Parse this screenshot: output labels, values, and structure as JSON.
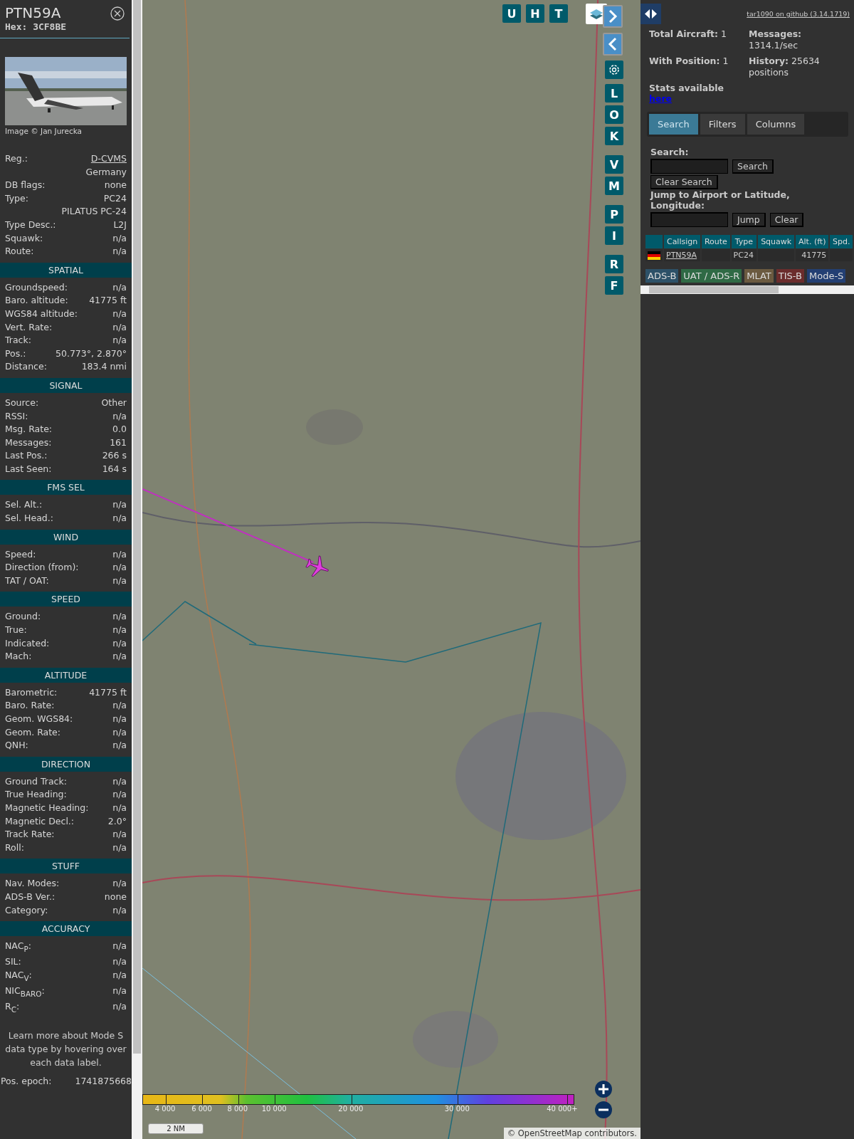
{
  "sidebar": {
    "title": "PTN59A",
    "hex": "Hex: 3CF8BE",
    "photo_credit": "Image © Jan Jurecka",
    "info_rows": [
      {
        "label": "Reg.:",
        "value": "D-CVMS",
        "kind": "link"
      },
      {
        "value": "Germany"
      },
      {
        "label": "DB flags:",
        "value": "none"
      },
      {
        "label": "Type:",
        "value": "PC24"
      },
      {
        "value": "PILATUS PC-24"
      },
      {
        "label": "Type Desc.:",
        "value": "L2J"
      },
      {
        "label": "Squawk:",
        "value": "n/a"
      },
      {
        "label": "Route:",
        "value": "n/a"
      }
    ],
    "sections": [
      {
        "heading": "SPATIAL",
        "rows": [
          {
            "label": "Groundspeed:",
            "value": "n/a"
          },
          {
            "label": "Baro. altitude:",
            "value": "41775 ft"
          },
          {
            "label": "WGS84 altitude:",
            "value": "n/a"
          },
          {
            "label": "Vert. Rate:",
            "value": "n/a"
          },
          {
            "label": "Track:",
            "value": "n/a"
          },
          {
            "label": "Pos.:",
            "value": "50.773°, 2.870°"
          },
          {
            "label": "Distance:",
            "value": "183.4 nmi"
          }
        ]
      },
      {
        "heading": "SIGNAL",
        "rows": [
          {
            "label": "Source:",
            "value": "Other"
          },
          {
            "label": "RSSI:",
            "value": "n/a"
          },
          {
            "label": "Msg. Rate:",
            "value": "0.0"
          },
          {
            "label": "Messages:",
            "value": "161"
          },
          {
            "label": "Last Pos.:",
            "value": "266 s"
          },
          {
            "label": "Last Seen:",
            "value": "164 s"
          }
        ]
      },
      {
        "heading": "FMS SEL",
        "rows": [
          {
            "label": "Sel. Alt.:",
            "value": "n/a"
          },
          {
            "label": "Sel. Head.:",
            "value": "n/a"
          }
        ]
      },
      {
        "heading": "WIND",
        "rows": [
          {
            "label": "Speed:",
            "value": "n/a"
          },
          {
            "label": "Direction (from):",
            "value": "n/a"
          },
          {
            "label": "TAT / OAT:",
            "value": "n/a"
          }
        ]
      },
      {
        "heading": "SPEED",
        "rows": [
          {
            "label": "Ground:",
            "value": "n/a"
          },
          {
            "label": "True:",
            "value": "n/a"
          },
          {
            "label": "Indicated:",
            "value": "n/a"
          },
          {
            "label": "Mach:",
            "value": "n/a"
          }
        ]
      },
      {
        "heading": "ALTITUDE",
        "rows": [
          {
            "label": "Barometric:",
            "value": "41775 ft"
          },
          {
            "label": "Baro. Rate:",
            "value": "n/a"
          },
          {
            "label": "Geom. WGS84:",
            "value": "n/a"
          },
          {
            "label": "Geom. Rate:",
            "value": "n/a"
          },
          {
            "label": "QNH:",
            "value": "n/a"
          }
        ]
      },
      {
        "heading": "DIRECTION",
        "rows": [
          {
            "label": "Ground Track:",
            "value": "n/a"
          },
          {
            "label": "True Heading:",
            "value": "n/a"
          },
          {
            "label": "Magnetic Heading:",
            "value": "n/a"
          },
          {
            "label": "Magnetic Decl.:",
            "value": "2.0°"
          },
          {
            "label": "Track Rate:",
            "value": "n/a"
          },
          {
            "label": "Roll:",
            "value": "n/a"
          }
        ]
      },
      {
        "heading": "STUFF",
        "rows": [
          {
            "label": "Nav. Modes:",
            "value": "n/a"
          },
          {
            "label": "ADS-B Ver.:",
            "value": "none"
          },
          {
            "label": "Category:",
            "value": "n/a"
          }
        ]
      },
      {
        "heading": "ACCURACY",
        "rows": [
          {
            "label": "NAC$_{P}$:",
            "value": "n/a"
          },
          {
            "label": "SIL:",
            "value": "n/a"
          },
          {
            "label": "NAC$_{V}$:",
            "value": "n/a"
          },
          {
            "label": "NIC$_{BARO}$:",
            "value": "n/a"
          },
          {
            "label": "R$_{C}$:",
            "value": "n/a"
          }
        ]
      }
    ],
    "note": "Learn more about Mode S data type by hovering over each data label.",
    "epoch": {
      "label": "Pos. epoch:",
      "value": "1741875668"
    }
  },
  "map": {
    "top_buttons": [
      {
        "kind": "letter",
        "label": "U"
      },
      {
        "kind": "letter",
        "label": "H"
      },
      {
        "kind": "letter",
        "label": "T"
      },
      {
        "kind": "layers"
      }
    ],
    "side_buttons": [
      {
        "kind": "next"
      },
      {
        "kind": "prev"
      },
      {
        "kind": "settings"
      },
      {
        "kind": "letter",
        "label": "L"
      },
      {
        "kind": "letter",
        "label": "O"
      },
      {
        "kind": "letter",
        "label": "K"
      },
      {
        "kind": "letter",
        "label": "V"
      },
      {
        "kind": "letter",
        "label": "M"
      },
      {
        "kind": "letter",
        "label": "P"
      },
      {
        "kind": "letter",
        "label": "I"
      },
      {
        "kind": "letter",
        "label": "R"
      },
      {
        "kind": "letter",
        "label": "F"
      }
    ],
    "altitude_legend": [
      "4 000",
      "6 000",
      "8 000",
      "10 000",
      "20 000",
      "30 000",
      "40 000+"
    ],
    "scale": "2 NM",
    "attribution": {
      "prefix": "©",
      "link": "OpenStreetMap",
      "suffix": "contributors."
    }
  },
  "right_panel": {
    "version_link": "tar1090 on github (3.14.1719)",
    "stats": [
      {
        "label": "Total Aircraft:",
        "value": "1"
      },
      {
        "label": "Messages:",
        "value": "1314.1/sec"
      },
      {
        "label": "With Position:",
        "value": "1"
      },
      {
        "label": "History:",
        "value": "25634 positions"
      }
    ],
    "stats_text": "Stats available",
    "stats_link": "here",
    "tabs": [
      {
        "label": "Search",
        "selected": true
      },
      {
        "label": "Filters",
        "selected": false
      },
      {
        "label": "Columns",
        "selected": false
      }
    ],
    "search_label": "Search:",
    "search_button": "Search",
    "clear_search_button": "Clear Search",
    "jump_label": "Jump to Airport or Latitude, Longitude:",
    "jump_button": "Jump",
    "clear_button": "Clear",
    "table": {
      "columns": [
        "Callsign",
        "Route",
        "Type",
        "Squawk",
        "Alt. (ft)",
        "Spd."
      ],
      "rows": [
        {
          "callsign": "PTN59A",
          "type": "PC24",
          "altitude": "41775"
        }
      ]
    },
    "legend": [
      {
        "label": "ADS-B",
        "color": "#2d5168"
      },
      {
        "label": "UAT / ADS-R",
        "color": "#2f6a45"
      },
      {
        "label": "MLAT",
        "color": "#6b5a40"
      },
      {
        "label": "TIS-B",
        "color": "#6b2c2c"
      },
      {
        "label": "Mode-S",
        "color": "#233f73"
      }
    ]
  }
}
